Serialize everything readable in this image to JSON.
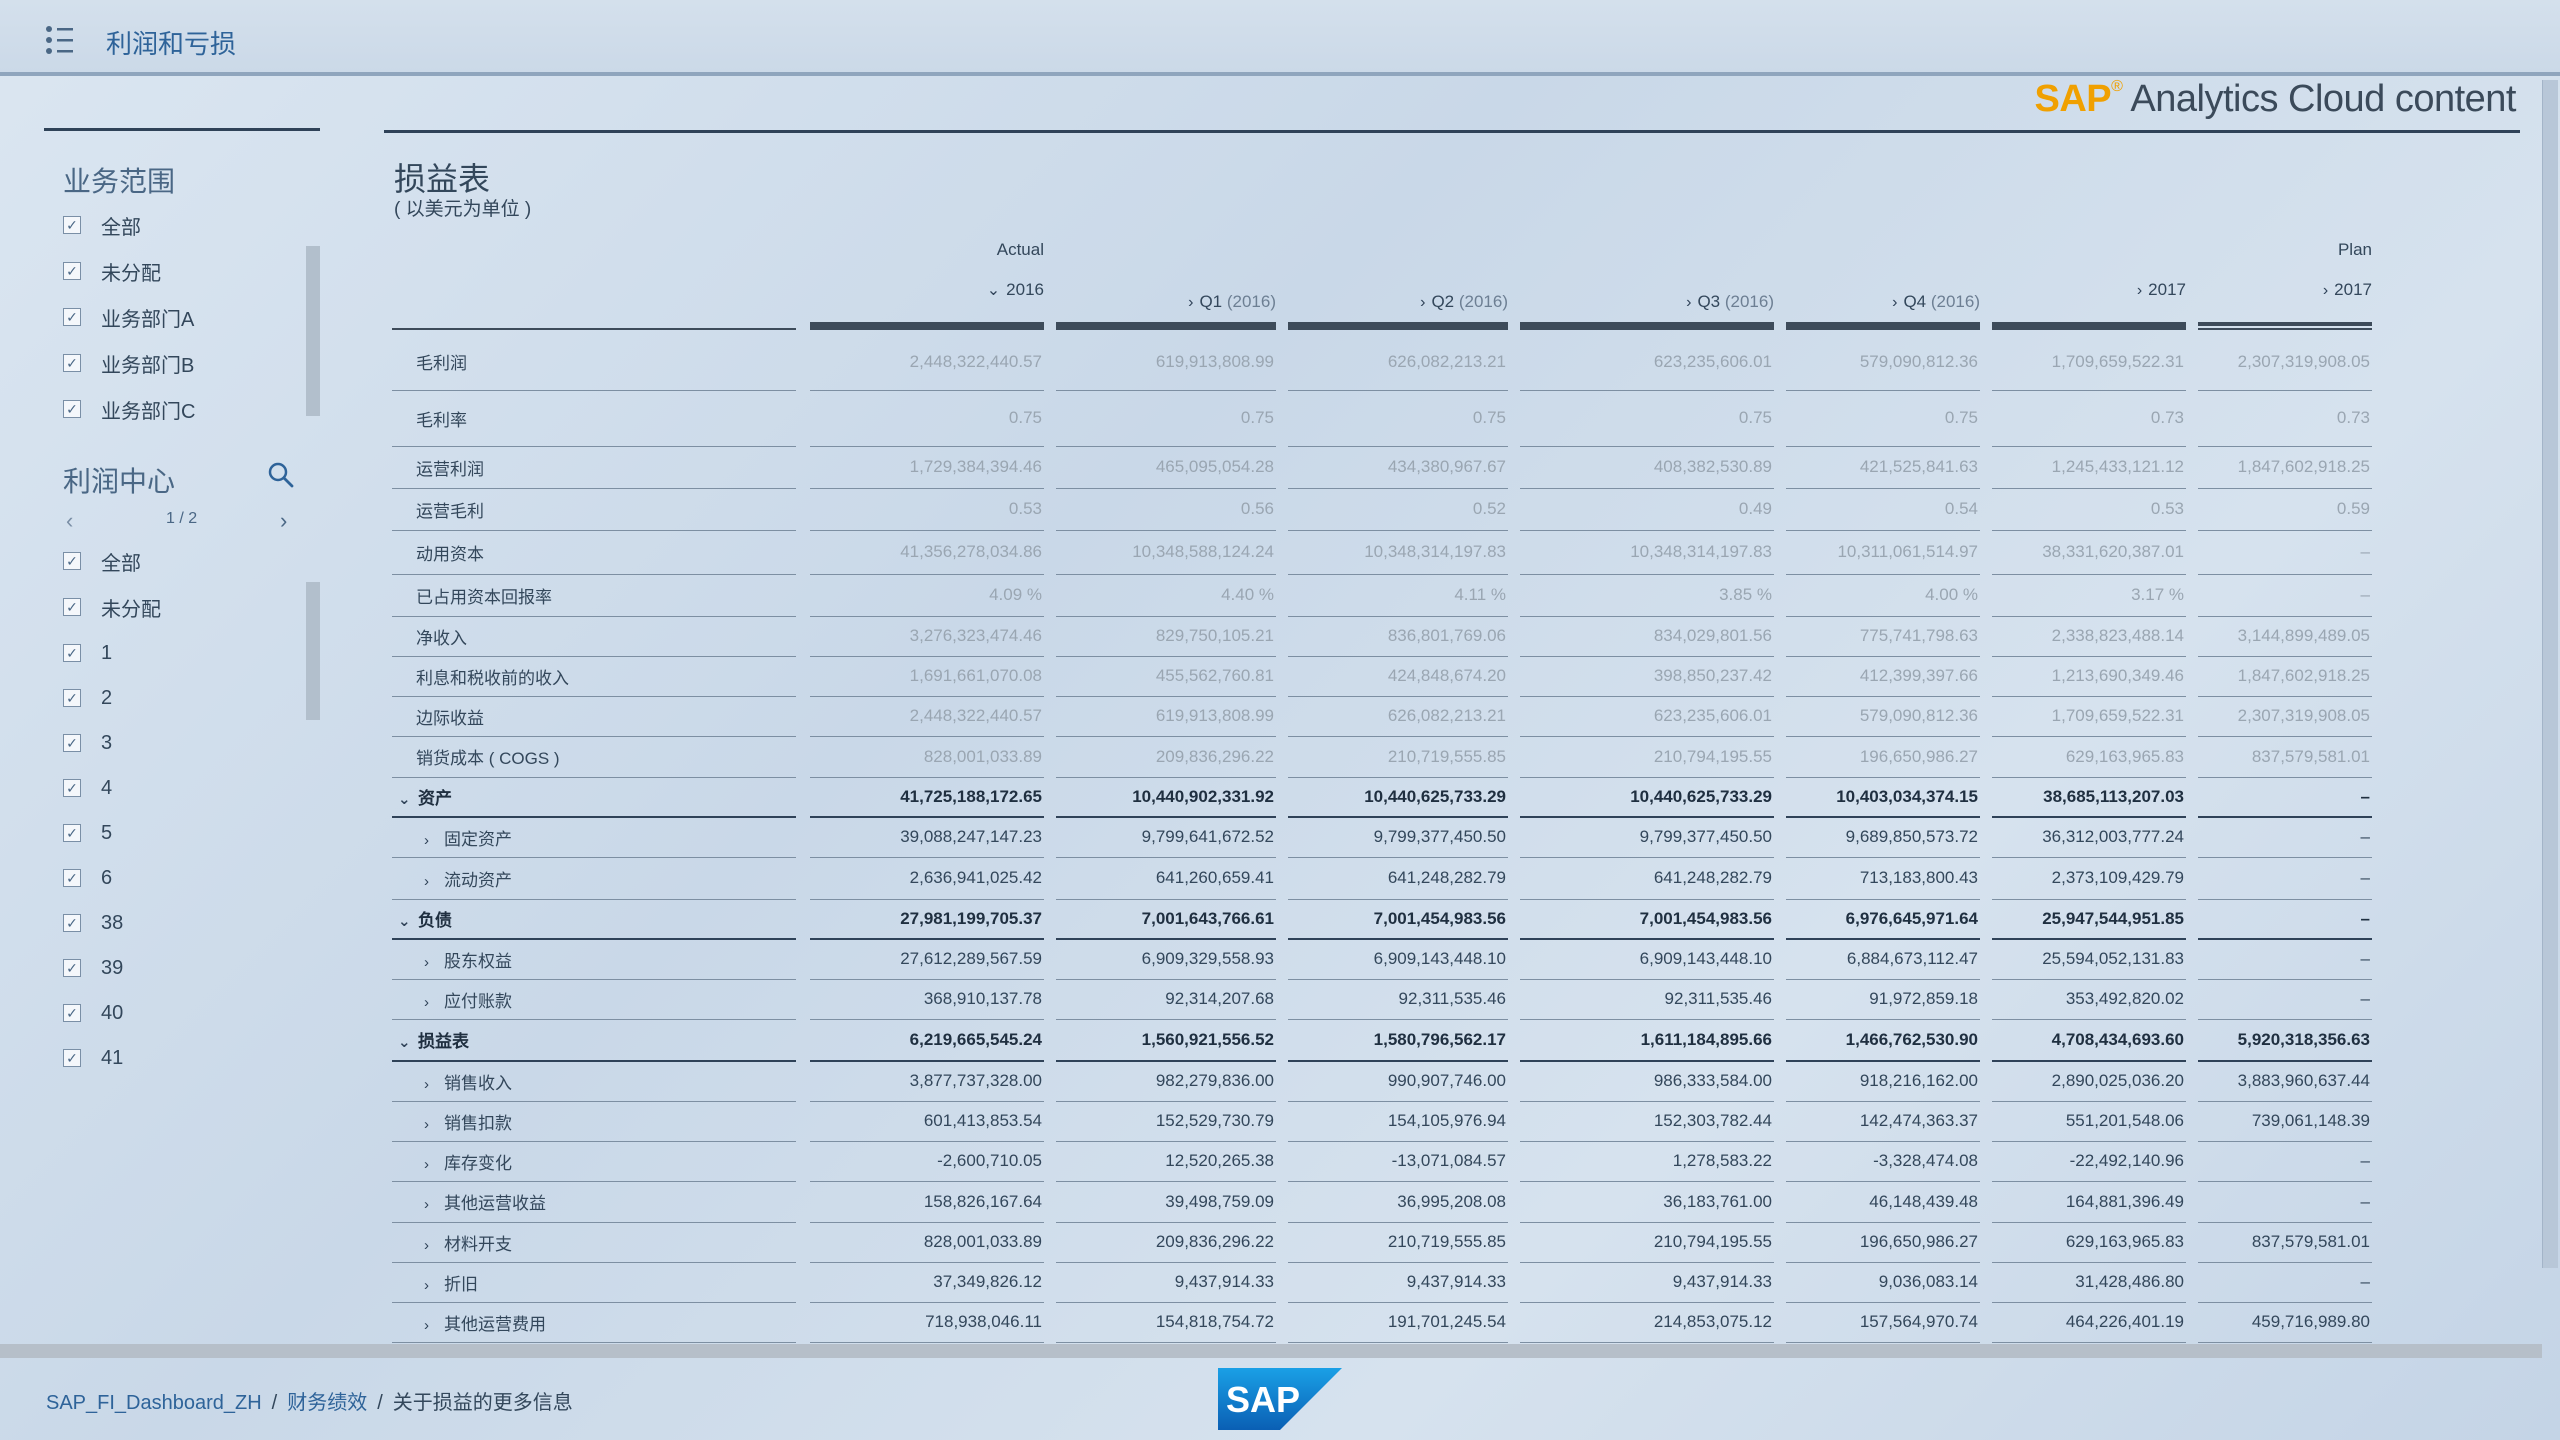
{
  "app": {
    "title": "利润和亏损"
  },
  "brand": {
    "sap": "SAP",
    "reg": "®",
    "rest": " Analytics Cloud content"
  },
  "filters": {
    "business_scope": {
      "title": "业务范围",
      "items": [
        "全部",
        "未分配",
        "业务部门A",
        "业务部门B",
        "业务部门C"
      ]
    },
    "profit_center": {
      "title": "利润中心",
      "page": "1 / 2",
      "items": [
        "全部",
        "未分配",
        "1",
        "2",
        "3",
        "4",
        "5",
        "6",
        "38",
        "39",
        "40",
        "41"
      ]
    },
    "check_glyph": "✓",
    "icons": [
      "search-icon",
      "chevron-left-icon",
      "chevron-right-icon",
      "menu-list-icon",
      "checkbox-checked-icon"
    ]
  },
  "report": {
    "title": "损益表",
    "subtitle": "( 以美元为单位 )",
    "version_labels": {
      "actual": "Actual",
      "plan": "Plan"
    },
    "columns": [
      {
        "label": "2016",
        "suffix": "",
        "chevron": "⌄"
      },
      {
        "label": "Q1",
        "suffix": "(2016)",
        "chevron": "›"
      },
      {
        "label": "Q2",
        "suffix": "(2016)",
        "chevron": "›"
      },
      {
        "label": "Q3",
        "suffix": "(2016)",
        "chevron": "›"
      },
      {
        "label": "Q4",
        "suffix": "(2016)",
        "chevron": "›"
      },
      {
        "label": "2017",
        "suffix": "",
        "chevron": "›"
      },
      {
        "label": "2017",
        "suffix": "",
        "chevron": "›"
      }
    ],
    "rows": [
      {
        "label": "毛利润",
        "values": [
          "2,448,322,440.57",
          "619,913,808.99",
          "626,082,213.21",
          "623,235,606.01",
          "579,090,812.36",
          "1,709,659,522.31",
          "2,307,319,908.05"
        ]
      },
      {
        "label": "毛利率",
        "values": [
          "0.75",
          "0.75",
          "0.75",
          "0.75",
          "0.75",
          "0.73",
          "0.73"
        ]
      },
      {
        "label": "运营利润",
        "values": [
          "1,729,384,394.46",
          "465,095,054.28",
          "434,380,967.67",
          "408,382,530.89",
          "421,525,841.63",
          "1,245,433,121.12",
          "1,847,602,918.25"
        ]
      },
      {
        "label": "运营毛利",
        "values": [
          "0.53",
          "0.56",
          "0.52",
          "0.49",
          "0.54",
          "0.53",
          "0.59"
        ]
      },
      {
        "label": "动用资本",
        "values": [
          "41,356,278,034.86",
          "10,348,588,124.24",
          "10,348,314,197.83",
          "10,348,314,197.83",
          "10,311,061,514.97",
          "38,331,620,387.01",
          "–"
        ]
      },
      {
        "label": "已占用资本回报率",
        "values": [
          "4.09 %",
          "4.40 %",
          "4.11 %",
          "3.85 %",
          "4.00 %",
          "3.17 %",
          "–"
        ]
      },
      {
        "label": "净收入",
        "values": [
          "3,276,323,474.46",
          "829,750,105.21",
          "836,801,769.06",
          "834,029,801.56",
          "775,741,798.63",
          "2,338,823,488.14",
          "3,144,899,489.05"
        ]
      },
      {
        "label": "利息和税收前的收入",
        "values": [
          "1,691,661,070.08",
          "455,562,760.81",
          "424,848,674.20",
          "398,850,237.42",
          "412,399,397.66",
          "1,213,690,349.46",
          "1,847,602,918.25"
        ]
      },
      {
        "label": "边际收益",
        "values": [
          "2,448,322,440.57",
          "619,913,808.99",
          "626,082,213.21",
          "623,235,606.01",
          "579,090,812.36",
          "1,709,659,522.31",
          "2,307,319,908.05"
        ]
      },
      {
        "label": "销货成本 ( COGS )",
        "values": [
          "828,001,033.89",
          "209,836,296.22",
          "210,719,555.85",
          "210,794,195.55",
          "196,650,986.27",
          "629,163,965.83",
          "837,579,581.01"
        ]
      },
      {
        "label": "资产",
        "kind": "head",
        "chevron": "⌄",
        "values": [
          "41,725,188,172.65",
          "10,440,902,331.92",
          "10,440,625,733.29",
          "10,440,625,733.29",
          "10,403,034,374.15",
          "38,685,113,207.03",
          "–"
        ]
      },
      {
        "label": "固定资产",
        "kind": "child",
        "chevron": "›",
        "values": [
          "39,088,247,147.23",
          "9,799,641,672.52",
          "9,799,377,450.50",
          "9,799,377,450.50",
          "9,689,850,573.72",
          "36,312,003,777.24",
          "–"
        ]
      },
      {
        "label": "流动资产",
        "kind": "child",
        "chevron": "›",
        "values": [
          "2,636,941,025.42",
          "641,260,659.41",
          "641,248,282.79",
          "641,248,282.79",
          "713,183,800.43",
          "2,373,109,429.79",
          "–"
        ]
      },
      {
        "label": "负债",
        "kind": "head",
        "chevron": "⌄",
        "values": [
          "27,981,199,705.37",
          "7,001,643,766.61",
          "7,001,454,983.56",
          "7,001,454,983.56",
          "6,976,645,971.64",
          "25,947,544,951.85",
          "–"
        ]
      },
      {
        "label": "股东权益",
        "kind": "child",
        "chevron": "›",
        "values": [
          "27,612,289,567.59",
          "6,909,329,558.93",
          "6,909,143,448.10",
          "6,909,143,448.10",
          "6,884,673,112.47",
          "25,594,052,131.83",
          "–"
        ]
      },
      {
        "label": "应付账款",
        "kind": "child",
        "chevron": "›",
        "values": [
          "368,910,137.78",
          "92,314,207.68",
          "92,311,535.46",
          "92,311,535.46",
          "91,972,859.18",
          "353,492,820.02",
          "–"
        ]
      },
      {
        "label": "损益表",
        "kind": "head",
        "chevron": "⌄",
        "values": [
          "6,219,665,545.24",
          "1,560,921,556.52",
          "1,580,796,562.17",
          "1,611,184,895.66",
          "1,466,762,530.90",
          "4,708,434,693.60",
          "5,920,318,356.63"
        ]
      },
      {
        "label": "销售收入",
        "kind": "child",
        "chevron": "›",
        "values": [
          "3,877,737,328.00",
          "982,279,836.00",
          "990,907,746.00",
          "986,333,584.00",
          "918,216,162.00",
          "2,890,025,036.20",
          "3,883,960,637.44"
        ]
      },
      {
        "label": "销售扣款",
        "kind": "child",
        "chevron": "›",
        "values": [
          "601,413,853.54",
          "152,529,730.79",
          "154,105,976.94",
          "152,303,782.44",
          "142,474,363.37",
          "551,201,548.06",
          "739,061,148.39"
        ]
      },
      {
        "label": "库存变化",
        "kind": "child",
        "chevron": "›",
        "values": [
          "-2,600,710.05",
          "12,520,265.38",
          "-13,071,084.57",
          "1,278,583.22",
          "-3,328,474.08",
          "-22,492,140.96",
          "–"
        ]
      },
      {
        "label": "其他运营收益",
        "kind": "child",
        "chevron": "›",
        "values": [
          "158,826,167.64",
          "39,498,759.09",
          "36,995,208.08",
          "36,183,761.00",
          "46,148,439.48",
          "164,881,396.49",
          "–"
        ]
      },
      {
        "label": "材料开支",
        "kind": "child",
        "chevron": "›",
        "values": [
          "828,001,033.89",
          "209,836,296.22",
          "210,719,555.85",
          "210,794,195.55",
          "196,650,986.27",
          "629,163,965.83",
          "837,579,581.01"
        ]
      },
      {
        "label": "折旧",
        "kind": "child",
        "chevron": "›",
        "values": [
          "37,349,826.12",
          "9,437,914.33",
          "9,437,914.33",
          "9,437,914.33",
          "9,036,083.14",
          "31,428,486.80",
          "–"
        ]
      },
      {
        "label": "其他运营费用",
        "kind": "child",
        "chevron": "›",
        "values": [
          "718,938,046.11",
          "154,818,754.72",
          "191,701,245.54",
          "214,853,075.12",
          "157,564,970.74",
          "464,226,401.19",
          "459,716,989.80"
        ]
      }
    ]
  },
  "breadcrumb": {
    "items": [
      "SAP_FI_Dashboard_ZH",
      "财务绩效",
      "关于损益的更多信息"
    ],
    "separator": "/"
  },
  "footer_logo": {
    "text": "SAP"
  },
  "colors": {
    "accent": "#2e6399",
    "brand_orange": "#f0a000",
    "sap_blue": "#0a6ed1",
    "text": "#33475b",
    "muted": "#9aa6b2"
  }
}
